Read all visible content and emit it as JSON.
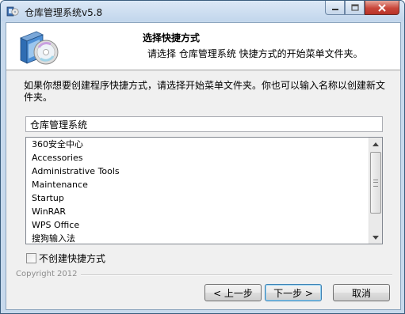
{
  "window": {
    "title": "仓库管理系统v5.8"
  },
  "header": {
    "title": "选择快捷方式",
    "subtitle": "请选择 仓库管理系统 快捷方式的开始菜单文件夹。"
  },
  "instruction": "如果你想要创建程序快捷方式，请选择开始菜单文件夹。你也可以输入名称以创建新文件夹。",
  "folder_input": {
    "value": "仓库管理系统"
  },
  "folder_list": [
    "360安全中心",
    "Accessories",
    "Administrative Tools",
    "Maintenance",
    "Startup",
    "WinRAR",
    "WPS Office",
    "搜狗输入法"
  ],
  "no_shortcut_checkbox": {
    "label": "不创建快捷方式",
    "checked": false
  },
  "footer": {
    "copyright": "Copyright 2012"
  },
  "buttons": {
    "back": "< 上一步",
    "next": "下一步 >",
    "cancel": "取消"
  },
  "icons": {
    "app": "installer-icon",
    "header": "cd-box-icon"
  }
}
